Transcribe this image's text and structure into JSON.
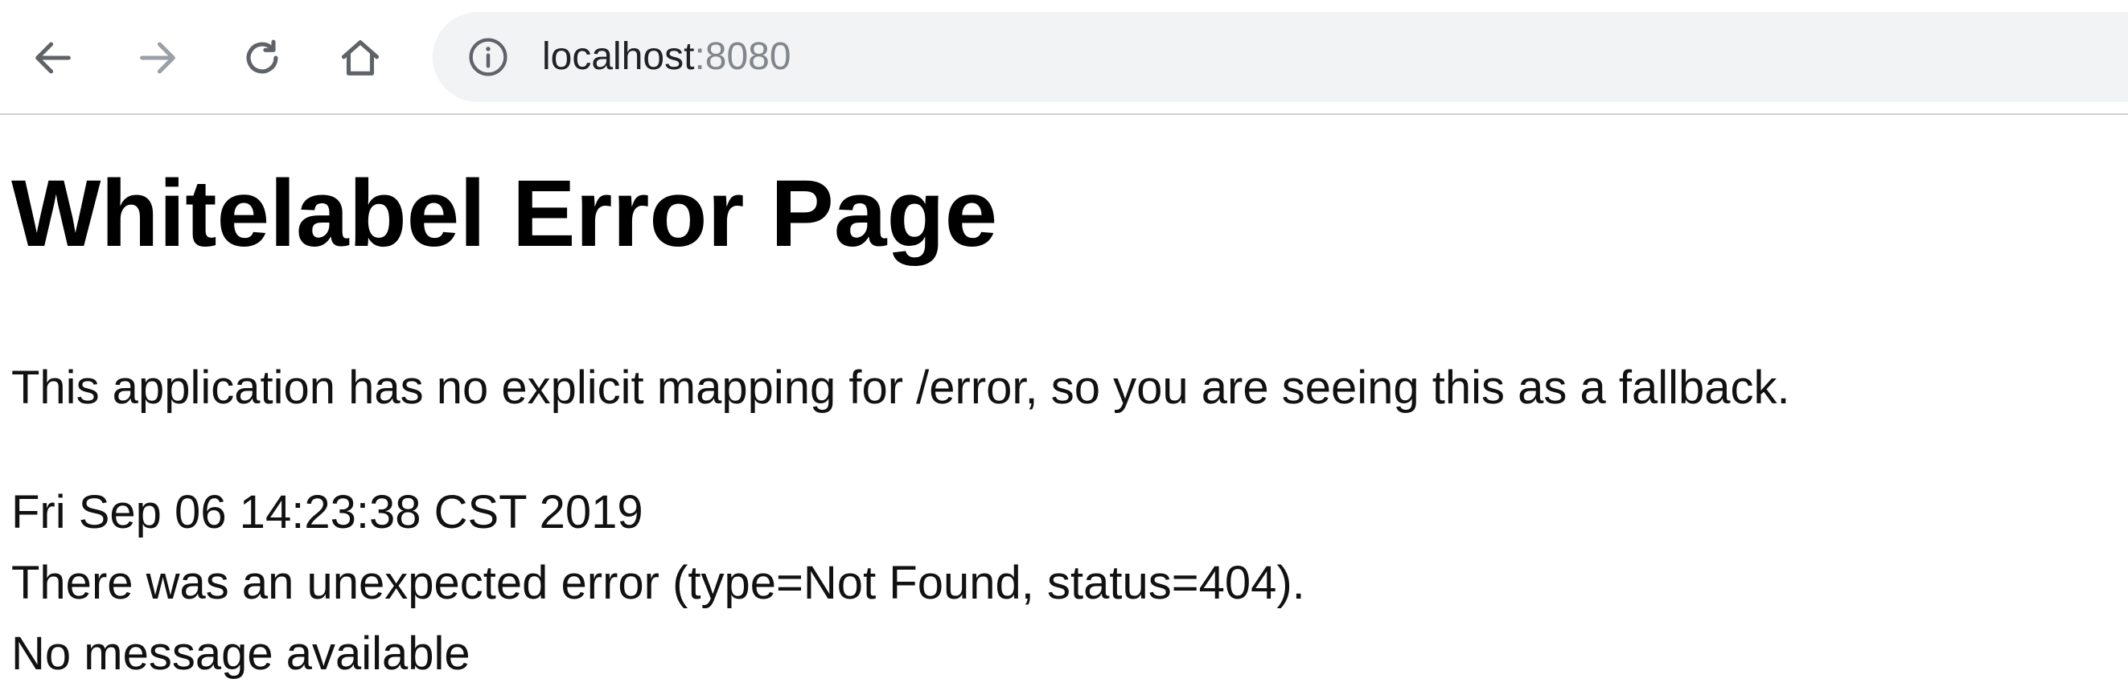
{
  "browser": {
    "nav": {
      "back_icon": "arrow-left-icon",
      "forward_icon": "arrow-right-icon",
      "reload_icon": "reload-icon",
      "home_icon": "home-icon"
    },
    "address_bar": {
      "security_icon": "info-icon",
      "host": "localhost",
      "port": ":8080"
    },
    "colors": {
      "omnibox_bg": "#f1f3f4",
      "forward_disabled": "#9aa0a6"
    }
  },
  "page": {
    "title": "Whitelabel Error Page",
    "explanation": "This application has no explicit mapping for /error, so you are seeing this as a fallback.",
    "timestamp": "Fri Sep 06 14:23:38 CST 2019",
    "error_detail": "There was an unexpected error (type=Not Found, status=404).",
    "message": "No message available"
  }
}
